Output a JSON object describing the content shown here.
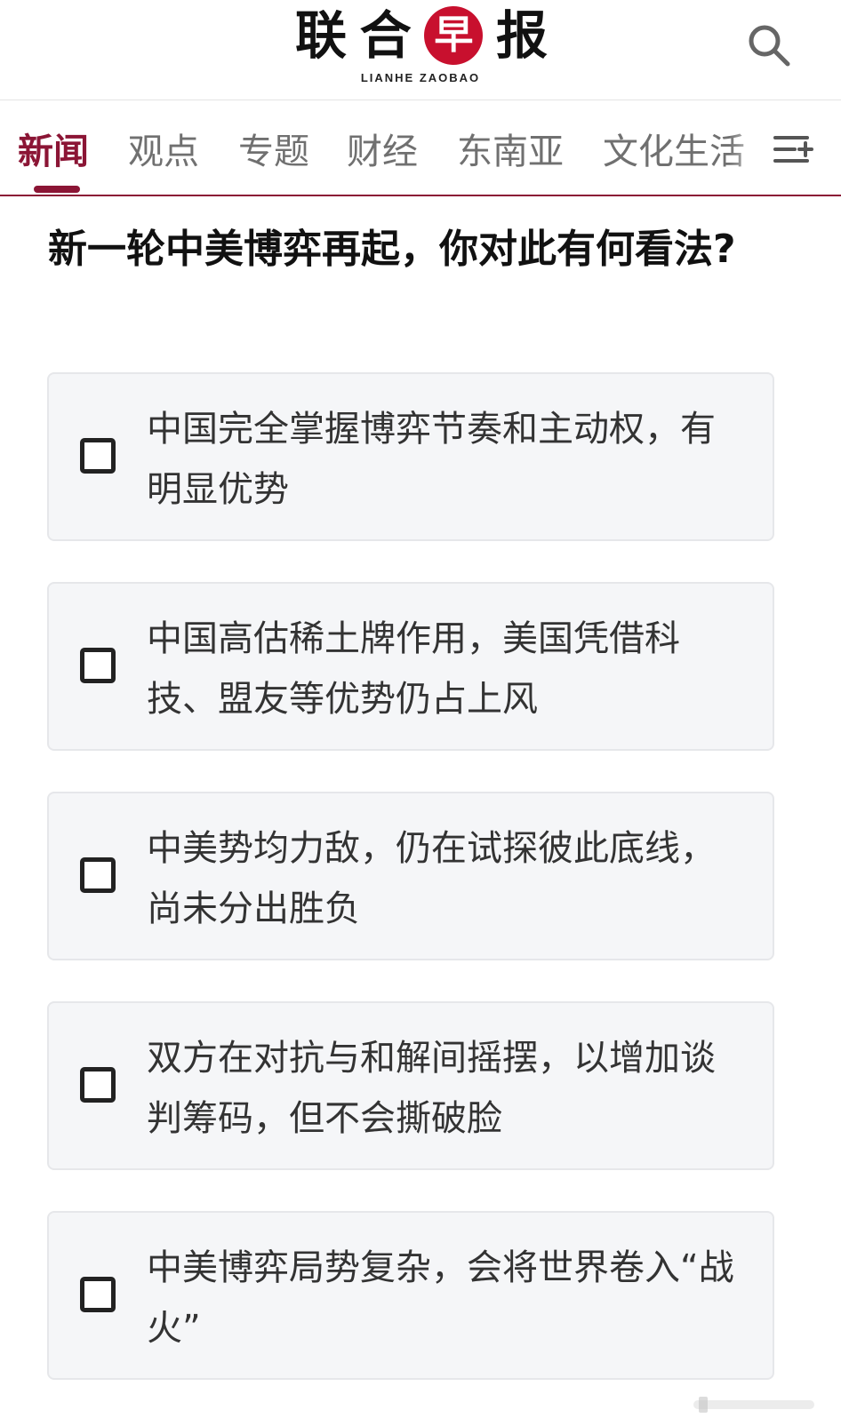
{
  "header": {
    "logo_chars": [
      "联",
      "合",
      "早",
      "报"
    ],
    "logo_latin": "LIANHE ZAOBAO",
    "brand_color": "#c8102e",
    "search_icon": "search-icon"
  },
  "nav": {
    "tabs": [
      {
        "label": "新闻",
        "active": true
      },
      {
        "label": "观点",
        "active": false
      },
      {
        "label": "专题",
        "active": false
      },
      {
        "label": "财经",
        "active": false
      },
      {
        "label": "东南亚",
        "active": false
      },
      {
        "label": "文化生活",
        "active": false
      }
    ],
    "accent_color": "#8b1535",
    "menu_icon": "menu-add-icon"
  },
  "poll": {
    "question": "新一轮中美博弈再起，你对此有何看法?",
    "options": [
      {
        "label": "中国完全掌握博弈节奏和主动权，有明显优势",
        "checked": false
      },
      {
        "label": "中国高估稀土牌作用，美国凭借科技、盟友等优势仍占上风",
        "checked": false
      },
      {
        "label": "中美势均力敌，仍在试探彼此底线，尚未分出胜负",
        "checked": false
      },
      {
        "label": "双方在对抗与和解间摇摆，以增加谈判筹码，但不会撕破脸",
        "checked": false
      },
      {
        "label": "中美博弈局势复杂，会将世界卷入“战火”",
        "checked": false
      }
    ]
  }
}
